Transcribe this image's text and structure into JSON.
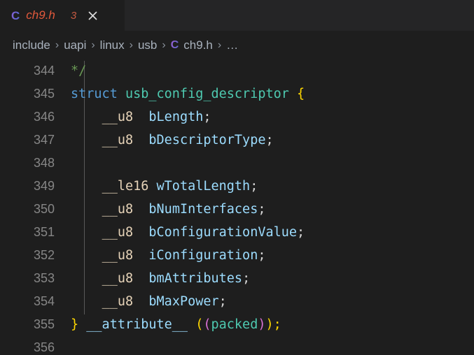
{
  "tab": {
    "icon": "c-file-icon",
    "filename": "ch9.h",
    "badge": "3",
    "close": "close-icon"
  },
  "breadcrumb": {
    "separator": "›",
    "items": [
      "include",
      "uapi",
      "linux",
      "usb"
    ],
    "file_icon": "C",
    "file": "ch9.h",
    "ellipsis": "…"
  },
  "editor": {
    "first_line": 344,
    "lines": [
      {
        "num": "344",
        "text": "    */"
      },
      {
        "num": "345",
        "text": "struct usb_config_descriptor {"
      },
      {
        "num": "346",
        "text": "    __u8  bLength;"
      },
      {
        "num": "347",
        "text": "    __u8  bDescriptorType;"
      },
      {
        "num": "348",
        "text": ""
      },
      {
        "num": "349",
        "text": "    __le16 wTotalLength;"
      },
      {
        "num": "350",
        "text": "    __u8  bNumInterfaces;"
      },
      {
        "num": "351",
        "text": "    __u8  bConfigurationValue;"
      },
      {
        "num": "352",
        "text": "    __u8  iConfiguration;"
      },
      {
        "num": "353",
        "text": "    __u8  bmAttributes;"
      },
      {
        "num": "354",
        "text": "    __u8  bMaxPower;"
      },
      {
        "num": "355",
        "text": "} __attribute__ ((packed));"
      },
      {
        "num": "356",
        "text": ""
      }
    ],
    "tokens": {
      "l344": {
        "comment": "*/"
      },
      "l345": {
        "keyword": "struct",
        "type": "usb_config_descriptor",
        "brace": "{"
      },
      "l346": {
        "macro": "__u8",
        "name": "bLength",
        "semi": ";"
      },
      "l347": {
        "macro": "__u8",
        "name": "bDescriptorType",
        "semi": ";"
      },
      "l349": {
        "macro": "__le16",
        "name": "wTotalLength",
        "semi": ";"
      },
      "l350": {
        "macro": "__u8",
        "name": "bNumInterfaces",
        "semi": ";"
      },
      "l351": {
        "macro": "__u8",
        "name": "bConfigurationValue",
        "semi": ";"
      },
      "l352": {
        "macro": "__u8",
        "name": "iConfiguration",
        "semi": ";"
      },
      "l353": {
        "macro": "__u8",
        "name": "bmAttributes",
        "semi": ";"
      },
      "l354": {
        "macro": "__u8",
        "name": "bMaxPower",
        "semi": ";"
      },
      "l355": {
        "close_brace": "}",
        "attribute": "__attribute__",
        "paren_outer_open": "(",
        "paren_inner_open": "(",
        "packed": "packed",
        "paren_inner_close": ")",
        "paren_outer_close": ")",
        "semi": ";"
      }
    }
  },
  "colors": {
    "background": "#1e1e1e",
    "tabbar_background": "#252526",
    "line_number": "#868686",
    "comment": "#6a9955",
    "keyword": "#569cd6",
    "type": "#4ec9b0",
    "variable": "#9cdcfe",
    "macro": "#e6d3b8",
    "bracket_yellow": "#ffd700",
    "bracket_magenta": "#da70d6",
    "modified_tab": "#e2593c"
  }
}
